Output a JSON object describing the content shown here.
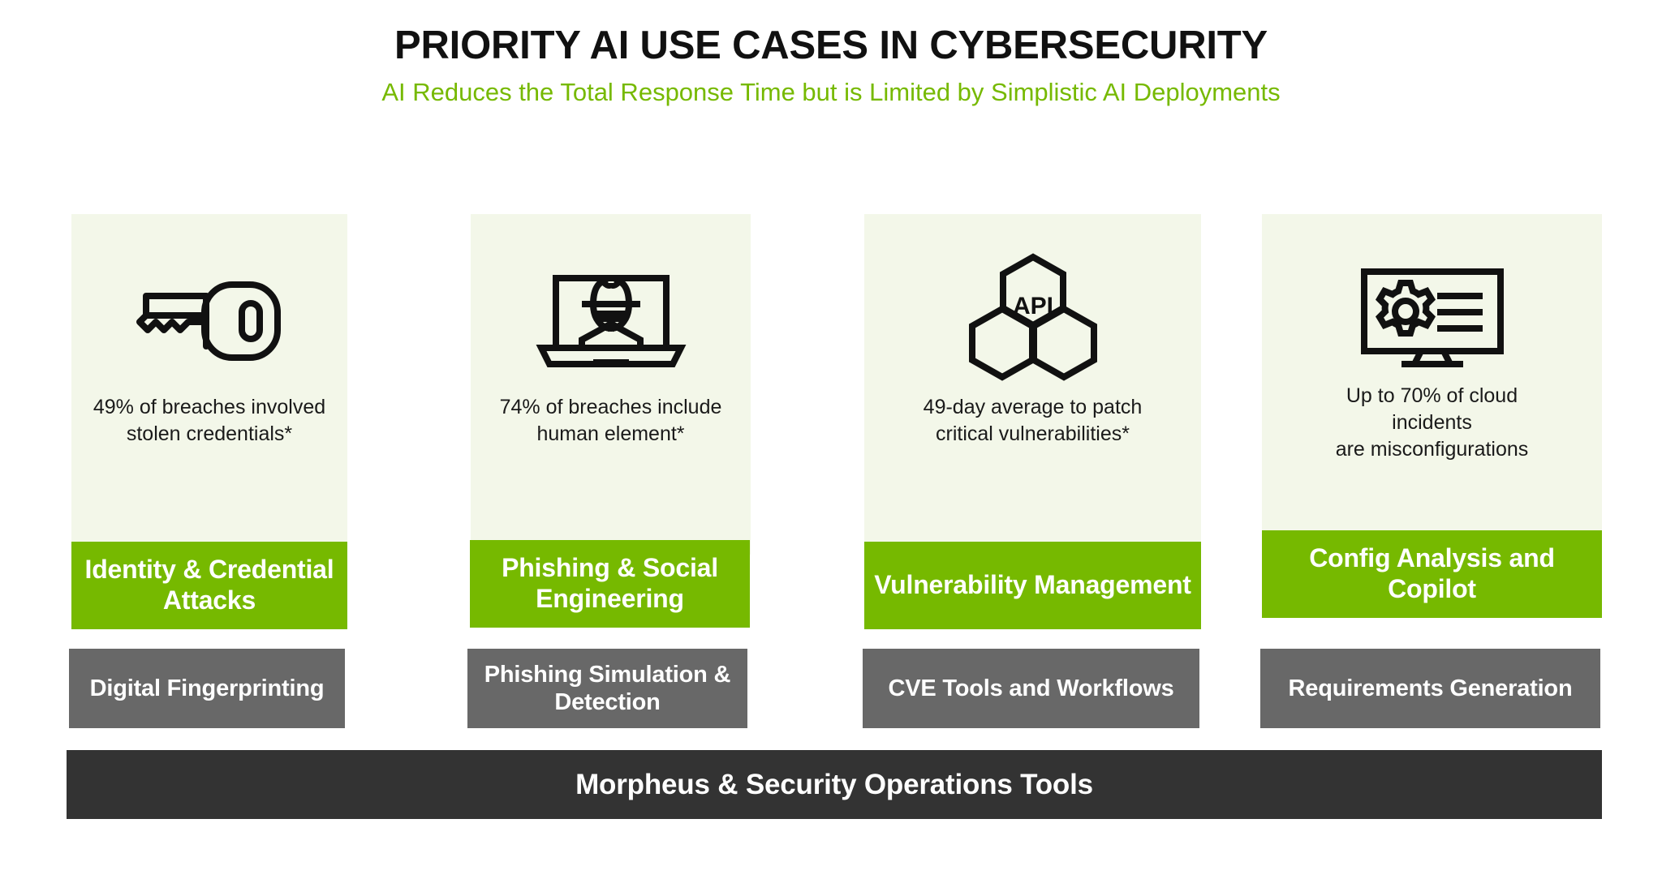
{
  "header": {
    "title": "PRIORITY AI USE CASES IN CYBERSECURITY",
    "subtitle": "AI Reduces the Total Response Time but is Limited by Simplistic AI Deployments"
  },
  "colors": {
    "accent_green": "#76b900",
    "panel_bg": "#f3f7e9",
    "gray_bar": "#686868",
    "footer_bar": "#333333",
    "title_text": "#111111",
    "white": "#ffffff"
  },
  "cards": [
    {
      "icon": "key-icon",
      "stat": "49% of breaches involved\nstolen credentials*",
      "stat_line1": "49% of breaches involved",
      "stat_line2": "stolen credentials*",
      "category": "Identity & Credential Attacks",
      "tool": "Digital Fingerprinting"
    },
    {
      "icon": "hacker-laptop-icon",
      "stat": "74% of breaches include\nhuman element*",
      "stat_line1": "74% of breaches include",
      "stat_line2": "human element*",
      "category": "Phishing & Social Engineering",
      "tool": "Phishing Simulation & Detection"
    },
    {
      "icon": "api-hexagons-icon",
      "stat": "49-day average to patch\ncritical vulnerabilities*",
      "stat_line1": "49-day average to patch",
      "stat_line2": "critical vulnerabilities*",
      "category": "Vulnerability Management",
      "tool": "CVE Tools and Workflows"
    },
    {
      "icon": "monitor-gear-icon",
      "stat": "Up to 70% of cloud incidents\nare misconfigurations",
      "stat_line1": "Up to 70% of cloud",
      "stat_line2": "incidents",
      "stat_line3": "are misconfigurations",
      "category": "Config Analysis and Copilot",
      "tool": "Requirements Generation"
    }
  ],
  "footer": {
    "label": "Morpheus & Security Operations Tools"
  },
  "icon_labels": {
    "api_text": "API"
  }
}
